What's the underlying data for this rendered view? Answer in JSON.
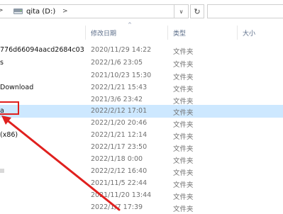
{
  "address": {
    "path_label": "qita (D:)",
    "separator": ">",
    "dropdown_glyph": "∨",
    "refresh_glyph": "↻"
  },
  "columns": {
    "date": "修改日期",
    "type": "类型",
    "size": "大小",
    "sort_glyph": "^"
  },
  "rows": [
    {
      "name": "776d66094aacd2684c03",
      "date": "2020/11/29 14:22",
      "type": "文件夹"
    },
    {
      "name": "s",
      "date": "2022/1/6 23:05",
      "type": "文件夹"
    },
    {
      "name": "",
      "date": "2021/10/23 15:30",
      "type": "文件夹"
    },
    {
      "name": "Download",
      "date": "2022/1/21 15:43",
      "type": "文件夹"
    },
    {
      "name": "",
      "date": "2021/3/6 23:42",
      "type": "文件夹"
    },
    {
      "name": "a",
      "date": "2022/2/12 17:01",
      "type": "文件夹"
    },
    {
      "name": "",
      "date": "2022/1/20 20:46",
      "type": "文件夹"
    },
    {
      "name": "(x86)",
      "date": "2022/1/21 12:14",
      "type": "文件夹"
    },
    {
      "name": "",
      "date": "2022/1/17 23:50",
      "type": "文件夹"
    },
    {
      "name": "",
      "date": "2022/1/18 0:00",
      "type": "文件夹"
    },
    {
      "name": "",
      "date": "2022/2/12 16:40",
      "type": "文件夹"
    },
    {
      "name": "",
      "date": "2021/11/5 22:44",
      "type": "文件夹"
    },
    {
      "name": "",
      "date": "2021/11/20 13:44",
      "type": "文件夹"
    },
    {
      "name": "",
      "date": "2022/1/7 17:39",
      "type": "文件夹"
    }
  ],
  "selected_row": "a",
  "colors": {
    "selection": "#cde8ff",
    "annotation": "#e0201e",
    "header_text": "#5b6d89"
  }
}
